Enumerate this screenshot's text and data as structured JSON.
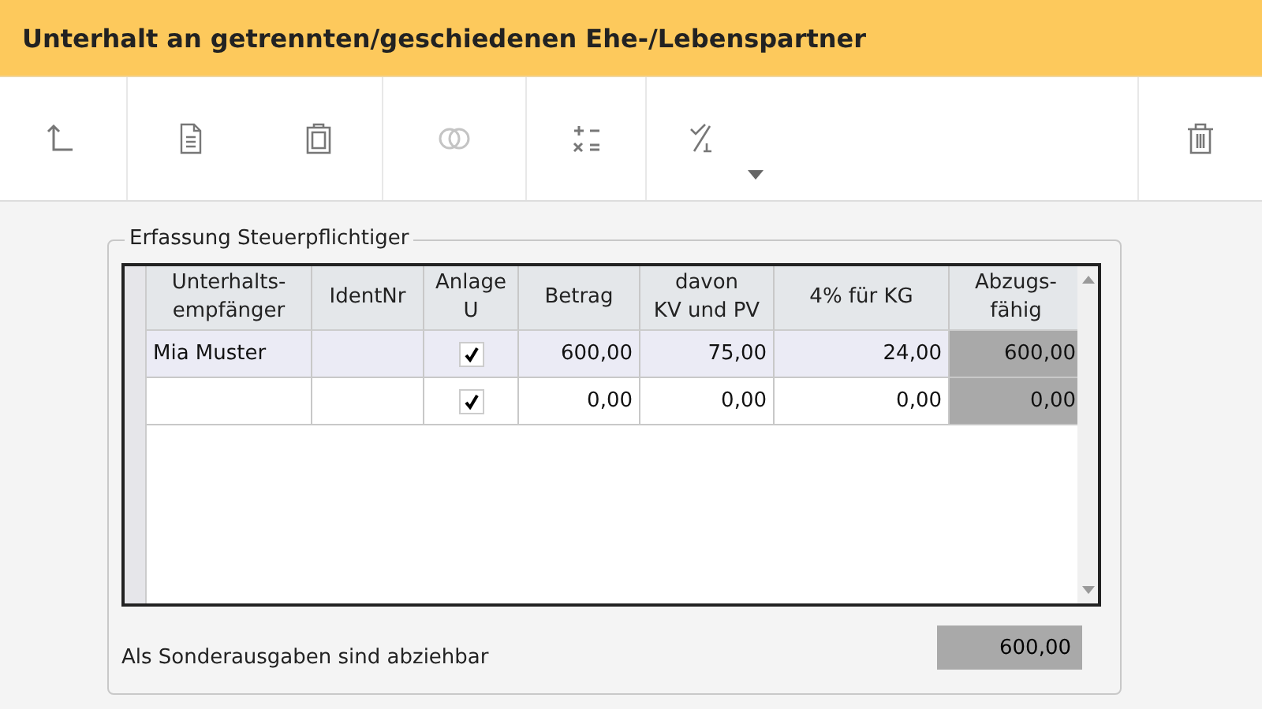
{
  "title": "Unterhalt an getrennten/geschiedenen Ehe-/Lebenspartner",
  "toolbar": [
    [
      {
        "kind": "up",
        "disabled": false
      }
    ],
    [
      {
        "kind": "document",
        "disabled": false
      },
      {
        "kind": "clipboard",
        "disabled": false
      }
    ],
    [
      {
        "kind": "rings",
        "disabled": true
      }
    ],
    [
      {
        "kind": "calc",
        "disabled": false
      }
    ],
    [
      {
        "kind": "check",
        "disabled": false,
        "dropdown": true
      }
    ],
    [
      {
        "kind": "delete",
        "disabled": false
      }
    ]
  ],
  "group": {
    "legend": "Erfassung Steuerpflichtiger",
    "columns": [
      "Unterhalts-\nempfänger",
      "IdentNr",
      "Anlage\nU",
      "Betrag",
      "davon\nKV und PV",
      "4% für KG",
      "Abzugs-\nfähig"
    ],
    "rows": [
      {
        "selected": true,
        "name": "Mia Muster",
        "ident_nr": "",
        "anlage_u": true,
        "betrag": "600,00",
        "davon": "75,00",
        "kg": "24,00",
        "abzugsfaehig": "600,00"
      },
      {
        "selected": false,
        "name": "",
        "ident_nr": "",
        "anlage_u": true,
        "betrag": "0,00",
        "davon": "0,00",
        "kg": "0,00",
        "abzugsfaehig": "0,00"
      }
    ],
    "total_label": "Als Sonderausgaben sind abziehbar",
    "total": "600,00"
  }
}
